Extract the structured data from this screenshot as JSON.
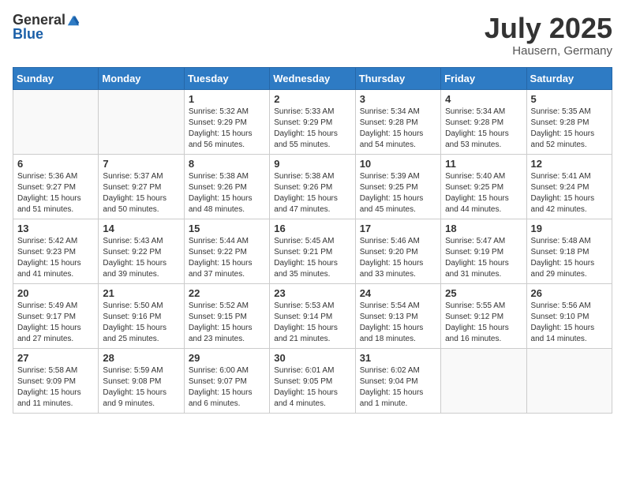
{
  "header": {
    "logo_general": "General",
    "logo_blue": "Blue",
    "month": "July 2025",
    "location": "Hausern, Germany"
  },
  "weekdays": [
    "Sunday",
    "Monday",
    "Tuesday",
    "Wednesday",
    "Thursday",
    "Friday",
    "Saturday"
  ],
  "weeks": [
    [
      {
        "day": "",
        "sunrise": "",
        "sunset": "",
        "daylight": ""
      },
      {
        "day": "",
        "sunrise": "",
        "sunset": "",
        "daylight": ""
      },
      {
        "day": "1",
        "sunrise": "Sunrise: 5:32 AM",
        "sunset": "Sunset: 9:29 PM",
        "daylight": "Daylight: 15 hours and 56 minutes."
      },
      {
        "day": "2",
        "sunrise": "Sunrise: 5:33 AM",
        "sunset": "Sunset: 9:29 PM",
        "daylight": "Daylight: 15 hours and 55 minutes."
      },
      {
        "day": "3",
        "sunrise": "Sunrise: 5:34 AM",
        "sunset": "Sunset: 9:28 PM",
        "daylight": "Daylight: 15 hours and 54 minutes."
      },
      {
        "day": "4",
        "sunrise": "Sunrise: 5:34 AM",
        "sunset": "Sunset: 9:28 PM",
        "daylight": "Daylight: 15 hours and 53 minutes."
      },
      {
        "day": "5",
        "sunrise": "Sunrise: 5:35 AM",
        "sunset": "Sunset: 9:28 PM",
        "daylight": "Daylight: 15 hours and 52 minutes."
      }
    ],
    [
      {
        "day": "6",
        "sunrise": "Sunrise: 5:36 AM",
        "sunset": "Sunset: 9:27 PM",
        "daylight": "Daylight: 15 hours and 51 minutes."
      },
      {
        "day": "7",
        "sunrise": "Sunrise: 5:37 AM",
        "sunset": "Sunset: 9:27 PM",
        "daylight": "Daylight: 15 hours and 50 minutes."
      },
      {
        "day": "8",
        "sunrise": "Sunrise: 5:38 AM",
        "sunset": "Sunset: 9:26 PM",
        "daylight": "Daylight: 15 hours and 48 minutes."
      },
      {
        "day": "9",
        "sunrise": "Sunrise: 5:38 AM",
        "sunset": "Sunset: 9:26 PM",
        "daylight": "Daylight: 15 hours and 47 minutes."
      },
      {
        "day": "10",
        "sunrise": "Sunrise: 5:39 AM",
        "sunset": "Sunset: 9:25 PM",
        "daylight": "Daylight: 15 hours and 45 minutes."
      },
      {
        "day": "11",
        "sunrise": "Sunrise: 5:40 AM",
        "sunset": "Sunset: 9:25 PM",
        "daylight": "Daylight: 15 hours and 44 minutes."
      },
      {
        "day": "12",
        "sunrise": "Sunrise: 5:41 AM",
        "sunset": "Sunset: 9:24 PM",
        "daylight": "Daylight: 15 hours and 42 minutes."
      }
    ],
    [
      {
        "day": "13",
        "sunrise": "Sunrise: 5:42 AM",
        "sunset": "Sunset: 9:23 PM",
        "daylight": "Daylight: 15 hours and 41 minutes."
      },
      {
        "day": "14",
        "sunrise": "Sunrise: 5:43 AM",
        "sunset": "Sunset: 9:22 PM",
        "daylight": "Daylight: 15 hours and 39 minutes."
      },
      {
        "day": "15",
        "sunrise": "Sunrise: 5:44 AM",
        "sunset": "Sunset: 9:22 PM",
        "daylight": "Daylight: 15 hours and 37 minutes."
      },
      {
        "day": "16",
        "sunrise": "Sunrise: 5:45 AM",
        "sunset": "Sunset: 9:21 PM",
        "daylight": "Daylight: 15 hours and 35 minutes."
      },
      {
        "day": "17",
        "sunrise": "Sunrise: 5:46 AM",
        "sunset": "Sunset: 9:20 PM",
        "daylight": "Daylight: 15 hours and 33 minutes."
      },
      {
        "day": "18",
        "sunrise": "Sunrise: 5:47 AM",
        "sunset": "Sunset: 9:19 PM",
        "daylight": "Daylight: 15 hours and 31 minutes."
      },
      {
        "day": "19",
        "sunrise": "Sunrise: 5:48 AM",
        "sunset": "Sunset: 9:18 PM",
        "daylight": "Daylight: 15 hours and 29 minutes."
      }
    ],
    [
      {
        "day": "20",
        "sunrise": "Sunrise: 5:49 AM",
        "sunset": "Sunset: 9:17 PM",
        "daylight": "Daylight: 15 hours and 27 minutes."
      },
      {
        "day": "21",
        "sunrise": "Sunrise: 5:50 AM",
        "sunset": "Sunset: 9:16 PM",
        "daylight": "Daylight: 15 hours and 25 minutes."
      },
      {
        "day": "22",
        "sunrise": "Sunrise: 5:52 AM",
        "sunset": "Sunset: 9:15 PM",
        "daylight": "Daylight: 15 hours and 23 minutes."
      },
      {
        "day": "23",
        "sunrise": "Sunrise: 5:53 AM",
        "sunset": "Sunset: 9:14 PM",
        "daylight": "Daylight: 15 hours and 21 minutes."
      },
      {
        "day": "24",
        "sunrise": "Sunrise: 5:54 AM",
        "sunset": "Sunset: 9:13 PM",
        "daylight": "Daylight: 15 hours and 18 minutes."
      },
      {
        "day": "25",
        "sunrise": "Sunrise: 5:55 AM",
        "sunset": "Sunset: 9:12 PM",
        "daylight": "Daylight: 15 hours and 16 minutes."
      },
      {
        "day": "26",
        "sunrise": "Sunrise: 5:56 AM",
        "sunset": "Sunset: 9:10 PM",
        "daylight": "Daylight: 15 hours and 14 minutes."
      }
    ],
    [
      {
        "day": "27",
        "sunrise": "Sunrise: 5:58 AM",
        "sunset": "Sunset: 9:09 PM",
        "daylight": "Daylight: 15 hours and 11 minutes."
      },
      {
        "day": "28",
        "sunrise": "Sunrise: 5:59 AM",
        "sunset": "Sunset: 9:08 PM",
        "daylight": "Daylight: 15 hours and 9 minutes."
      },
      {
        "day": "29",
        "sunrise": "Sunrise: 6:00 AM",
        "sunset": "Sunset: 9:07 PM",
        "daylight": "Daylight: 15 hours and 6 minutes."
      },
      {
        "day": "30",
        "sunrise": "Sunrise: 6:01 AM",
        "sunset": "Sunset: 9:05 PM",
        "daylight": "Daylight: 15 hours and 4 minutes."
      },
      {
        "day": "31",
        "sunrise": "Sunrise: 6:02 AM",
        "sunset": "Sunset: 9:04 PM",
        "daylight": "Daylight: 15 hours and 1 minute."
      },
      {
        "day": "",
        "sunrise": "",
        "sunset": "",
        "daylight": ""
      },
      {
        "day": "",
        "sunrise": "",
        "sunset": "",
        "daylight": ""
      }
    ]
  ]
}
